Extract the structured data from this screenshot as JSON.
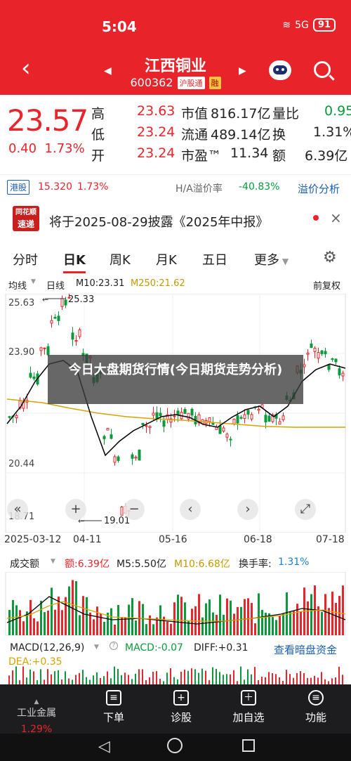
{
  "status": {
    "time": "5:04",
    "network": "5G",
    "battery": "91"
  },
  "header": {
    "name": "江西铜业",
    "code": "600362",
    "tag_market": "沪股通",
    "tag_margin": "融"
  },
  "quote": {
    "price": "23.57",
    "change": "0.40",
    "change_pct": "1.73%",
    "high_label": "高",
    "high": "23.63",
    "low_label": "低",
    "low": "23.24",
    "open_label": "开",
    "open": "23.24",
    "mcap_label": "市值",
    "mcap": "816.17亿",
    "float_label": "流通",
    "float": "489.14亿",
    "pe_label": "市盈™",
    "pe": "11.34",
    "ratio_label": "量比",
    "ratio": "0.95",
    "turnover_label": "换",
    "turnover": "1.31%",
    "amount_label": "额",
    "amount": "6.39亿"
  },
  "hk": {
    "tag": "港股",
    "price": "15.320",
    "pct": "1.73%",
    "premium_label": "H/A溢价率",
    "premium": "-40.83%",
    "link": "溢价分析"
  },
  "news": {
    "logo_top": "同花顺",
    "logo_bottom": "速递",
    "text": "将于2025-08-29披露《2025年中报》"
  },
  "tabs": [
    "分时",
    "日K",
    "周K",
    "月K",
    "五日",
    "更多"
  ],
  "active_tab": "日K",
  "chart_header": {
    "indicator": "均线",
    "period": "日线",
    "ma10": "M10:23.31",
    "ma250": "M250:21.62",
    "adjust": "前复权"
  },
  "price_axis": [
    "25.63",
    "23.90",
    "20.44",
    "18.71"
  ],
  "annotations": {
    "high": "25.33",
    "low": "19.01"
  },
  "dates": [
    "2025-03-12",
    "04-11",
    "05-16",
    "06-18",
    "07-18"
  ],
  "volume_header": {
    "label": "成交额",
    "amount": "额:6.39亿",
    "m5": "M5:5.50亿",
    "m10": "M10:6.68亿",
    "turnover_label": "换手率:",
    "turnover": "1.31%"
  },
  "macd_header": {
    "label": "MACD(12,26,9)",
    "macd": "MACD:-0.07",
    "diff": "DIFF:+0.31",
    "dea": "DEA:+0.35",
    "link": "查看暗盘资金"
  },
  "overlay_text": "今日大盘期货行情(今日期货走势分析)",
  "bottom_nav": [
    {
      "label": "工业金属",
      "sub": "1.29%"
    },
    {
      "label": "下单"
    },
    {
      "label": "诊股"
    },
    {
      "label": "加自选"
    },
    {
      "label": "功能"
    }
  ],
  "colors": {
    "up": "#e8252b",
    "down": "#0a9a3c",
    "ma10": "#000000",
    "ma250": "#d4a400",
    "brand": "#e8242a"
  }
}
